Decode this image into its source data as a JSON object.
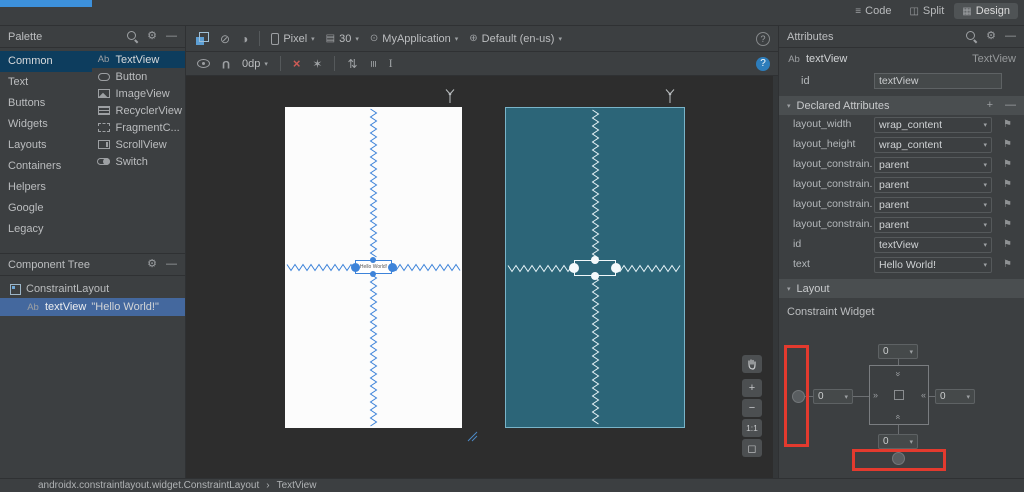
{
  "icons": {
    "ab": "Ab",
    "gear": "⚙",
    "minus": "—",
    "plus": "+",
    "caret": "▾",
    "flag": "⚑",
    "help": "?",
    "code_tab": "≡",
    "split_tab": "◫",
    "design_tab": "▦",
    "no_activity": "⊘",
    "contrast": "◑",
    "api_level": "▤",
    "theme": "⊙",
    "locale": "⊕",
    "magnet": "U",
    "clear_constraints": "×",
    "infer_constraints": "✶",
    "pack": "⇅",
    "align": "≡",
    "distribute": "I",
    "zoom_in": "+",
    "zoom_out": "−",
    "zoom_fit": "◻",
    "chev_in_r": "»",
    "chev_in_l": "«",
    "crumb_sep": "›",
    "section_chevron": "▾"
  },
  "topbar": {
    "tabs": [
      "Code",
      "Split",
      "Design"
    ]
  },
  "palette": {
    "title": "Palette",
    "categories": [
      "Common",
      "Text",
      "Buttons",
      "Widgets",
      "Layouts",
      "Containers",
      "Helpers",
      "Google",
      "Legacy"
    ],
    "components": [
      "TextView",
      "Button",
      "ImageView",
      "RecyclerView",
      "FragmentC...",
      "ScrollView",
      "Switch"
    ]
  },
  "tree": {
    "title": "Component Tree",
    "root": "ConstraintLayout",
    "child": "textView",
    "child_note": "\"Hello World!\""
  },
  "toolbar": {
    "device": "Pixel",
    "api": "30",
    "theme": "MyApplication",
    "locale": "Default (en-us)",
    "margin": "0dp"
  },
  "canvas": {
    "widget_text": "Hello World!"
  },
  "zoom": {
    "ratio": "1:1"
  },
  "attributes": {
    "title": "Attributes",
    "comp_name": "textView",
    "comp_type": "TextView",
    "id_label": "id",
    "id_value": "textView",
    "declared_title": "Declared Attributes",
    "layout_title": "Layout",
    "constraint_widget_title": "Constraint Widget",
    "rows": [
      {
        "name": "layout_width",
        "value": "wrap_content"
      },
      {
        "name": "layout_height",
        "value": "wrap_content"
      },
      {
        "name": "layout_constrain...",
        "value": "parent"
      },
      {
        "name": "layout_constrain...",
        "value": "parent"
      },
      {
        "name": "layout_constrain...",
        "value": "parent"
      },
      {
        "name": "layout_constrain...",
        "value": "parent"
      },
      {
        "name": "id",
        "value": "textView"
      },
      {
        "name": "text",
        "value": "Hello World!"
      }
    ],
    "margins": {
      "top": "0",
      "left": "0",
      "right": "0",
      "bottom": "0"
    }
  },
  "breadcrumb": [
    "androidx.constraintlayout.widget.ConstraintLayout",
    "TextView"
  ]
}
